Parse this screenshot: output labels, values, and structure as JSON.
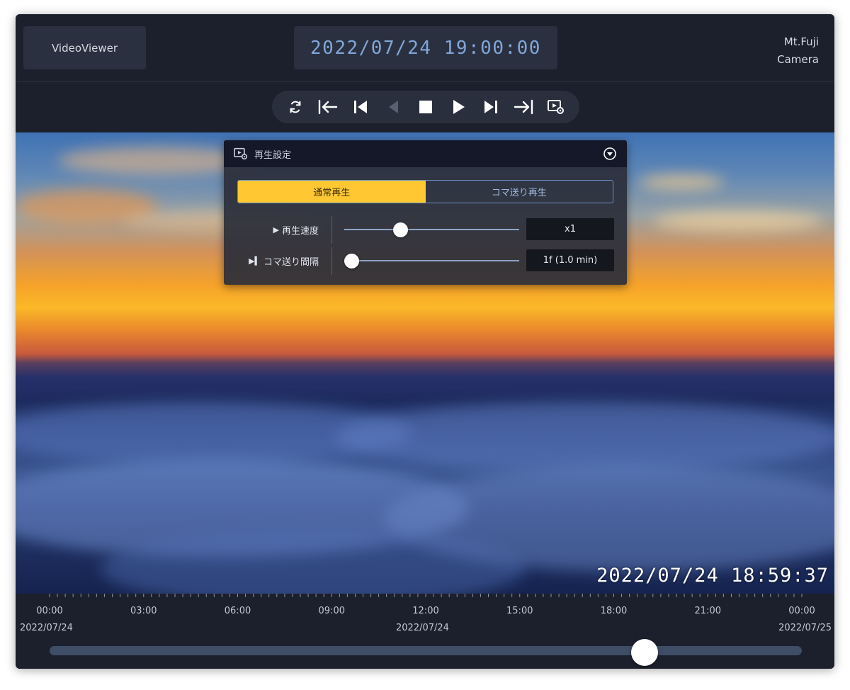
{
  "app": {
    "brand": "VideoViewer"
  },
  "header": {
    "datetime": "2022/07/24 19:00:00",
    "camera_line1": "Mt.Fuji",
    "camera_line2": "Camera"
  },
  "controls": {
    "buttons": [
      {
        "name": "loop-button",
        "icon": "loop-icon",
        "enabled": true
      },
      {
        "name": "jump-to-start-button",
        "icon": "jump-to-start-icon",
        "enabled": true
      },
      {
        "name": "previous-frame-button",
        "icon": "skip-back-icon",
        "enabled": true
      },
      {
        "name": "reverse-play-button",
        "icon": "play-reverse-icon",
        "enabled": false
      },
      {
        "name": "stop-button",
        "icon": "stop-icon",
        "enabled": true
      },
      {
        "name": "play-button",
        "icon": "play-icon",
        "enabled": true
      },
      {
        "name": "next-frame-button",
        "icon": "skip-forward-icon",
        "enabled": true
      },
      {
        "name": "jump-to-end-button",
        "icon": "jump-to-end-icon",
        "enabled": true
      },
      {
        "name": "playback-settings-button",
        "icon": "playback-settings-icon",
        "enabled": true
      }
    ]
  },
  "video": {
    "timestamp": "2022/07/24 18:59:37"
  },
  "settings_panel": {
    "title": "再生設定",
    "icon": "playback-settings-icon",
    "collapse_icon": "chevron-circle-down-icon",
    "modes": [
      {
        "label": "通常再生",
        "active": true
      },
      {
        "label": "コマ送り再生",
        "active": false
      }
    ],
    "speed": {
      "glyph": "▶",
      "label": "再生速度",
      "value": "x1",
      "level": 0.32
    },
    "interval": {
      "glyph": "▶▍",
      "label": "コマ送り間隔",
      "value": "1f (1.0 min)",
      "level": 0.0
    }
  },
  "timeline": {
    "times": [
      "00:00",
      "03:00",
      "06:00",
      "09:00",
      "12:00",
      "15:00",
      "18:00",
      "21:00",
      "00:00"
    ],
    "dates": [
      "2022/07/24",
      "2022/07/24",
      "2022/07/25"
    ],
    "position": 0.791
  },
  "colors": {
    "accent": "#ffc832",
    "clock": "#7fa6d8",
    "panel": "#2a2e3a",
    "background": "#1c202d"
  }
}
